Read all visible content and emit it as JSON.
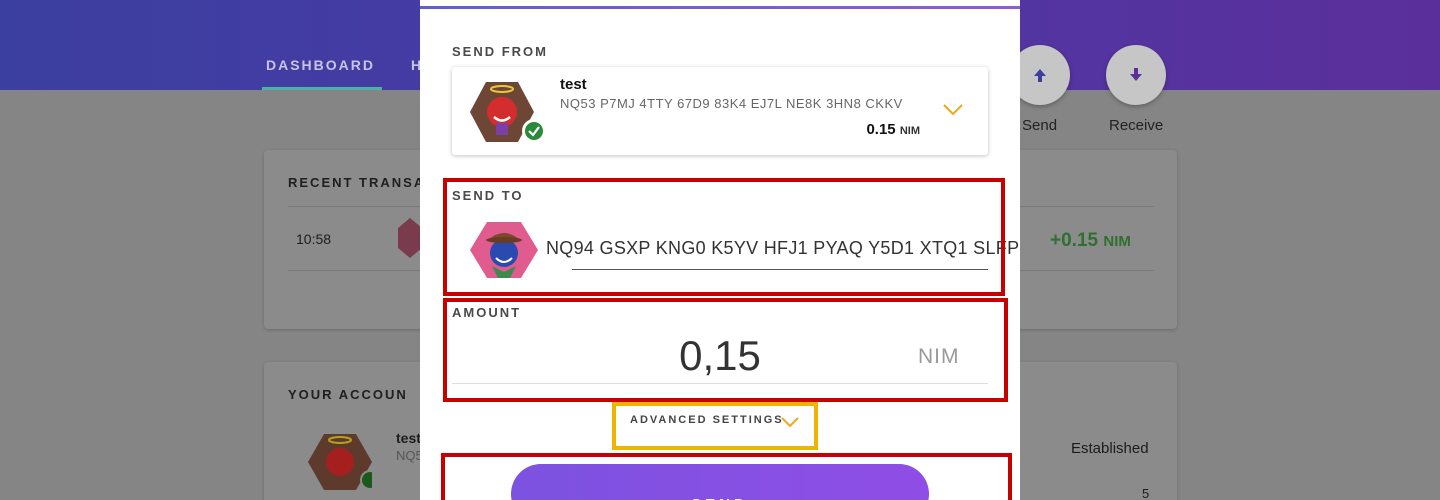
{
  "nav": {
    "tabs": [
      "DASHBOARD",
      "H"
    ]
  },
  "actions": {
    "send_label": "Send",
    "receive_label": "Receive"
  },
  "recent_transactions": {
    "title": "RECENT TRANSA",
    "row": {
      "time": "10:58",
      "amount": "+0.15",
      "unit": "NIM"
    }
  },
  "your_accounts": {
    "title": "YOUR ACCOUN",
    "row": {
      "name": "test",
      "address_fragment": "NQ5",
      "status": "Established",
      "count": "5"
    }
  },
  "send_dialog": {
    "send_from_label": "SEND FROM",
    "from_account": {
      "name": "test",
      "address": "NQ53 P7MJ 4TTY 67D9 83K4 EJ7L NE8K 3HN8 CKKV",
      "balance": "0.15",
      "unit": "NIM"
    },
    "send_to_label": "SEND TO",
    "recipient_address": "NQ94 GSXP KNG0 K5YV HFJ1 PYAQ Y5D1 XTQ1 SLFP",
    "amount_label": "AMOUNT",
    "amount_value": "0,15",
    "amount_unit": "NIM",
    "advanced_settings_label": "ADVANCED SETTINGS",
    "send_button_label": "SEND"
  },
  "colors": {
    "accent_purple": "#8a4fe4",
    "positive_green": "#2f8a2f",
    "highlight_red": "#c80000",
    "highlight_yellow": "#f0b400",
    "chevron_orange": "#f0a81c"
  },
  "icons": {
    "send_arrow": "arrow-up-icon",
    "receive_arrow": "arrow-down-icon",
    "dropdown": "chevron-down-icon",
    "verified": "check-circle-icon"
  }
}
